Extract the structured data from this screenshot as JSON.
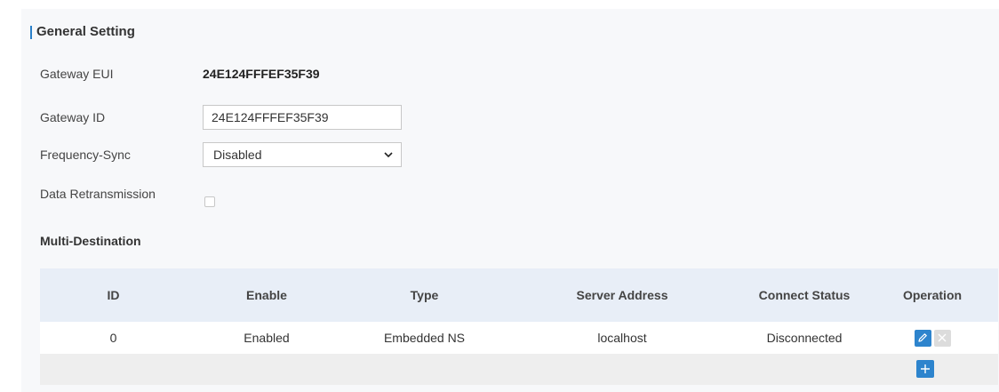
{
  "general": {
    "title": "General Setting",
    "gateway_eui_label": "Gateway EUI",
    "gateway_eui_value": "24E124FFFEF35F39",
    "gateway_id_label": "Gateway ID",
    "gateway_id_value": "24E124FFFEF35F39",
    "frequency_sync_label": "Frequency-Sync",
    "frequency_sync_value": "Disabled",
    "data_retransmission_label": "Data Retransmission",
    "data_retransmission_checked": false
  },
  "multi_destination": {
    "title": "Multi-Destination",
    "columns": [
      "ID",
      "Enable",
      "Type",
      "Server Address",
      "Connect Status",
      "Operation"
    ],
    "rows": [
      {
        "id": "0",
        "enable": "Enabled",
        "type": "Embedded NS",
        "server_address": "localhost",
        "connect_status": "Disconnected"
      }
    ]
  },
  "icons": {
    "edit": "pencil-icon",
    "delete": "close-icon",
    "add": "plus-icon",
    "select": "chevron-down-icon"
  },
  "colors": {
    "accent": "#2d84cd",
    "header_bg": "#e8eef7",
    "panel_bg": "#f7f8fa"
  }
}
